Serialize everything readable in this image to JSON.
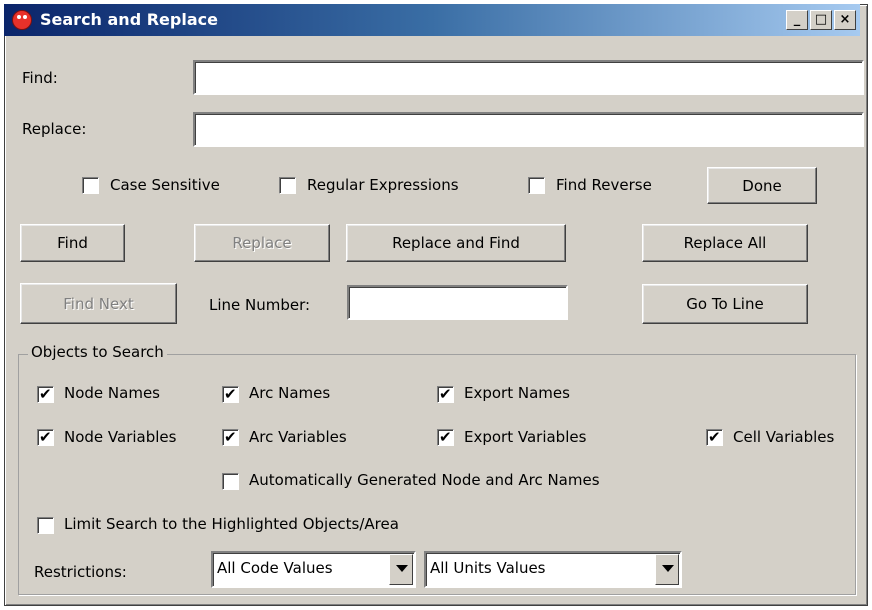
{
  "window": {
    "title": "Search and Replace",
    "controls": {
      "minimize": "_",
      "maximize": "□",
      "close": "×"
    }
  },
  "find": {
    "label": "Find:",
    "value": ""
  },
  "replace": {
    "label": "Replace:",
    "value": ""
  },
  "options": {
    "case_sensitive": {
      "label": "Case Sensitive",
      "checked": false
    },
    "regular_expressions": {
      "label": "Regular Expressions",
      "checked": false
    },
    "find_reverse": {
      "label": "Find Reverse",
      "checked": false
    }
  },
  "buttons": {
    "done": "Done",
    "find": "Find",
    "replace": "Replace",
    "replace_and_find": "Replace and Find",
    "replace_all": "Replace All",
    "find_next": "Find Next",
    "go_to_line": "Go To Line"
  },
  "line_number": {
    "label": "Line Number:",
    "value": ""
  },
  "objects_group": {
    "title": "Objects to Search",
    "node_names": {
      "label": "Node Names",
      "checked": true
    },
    "arc_names": {
      "label": "Arc Names",
      "checked": true
    },
    "export_names": {
      "label": "Export Names",
      "checked": true
    },
    "node_variables": {
      "label": "Node Variables",
      "checked": true
    },
    "arc_variables": {
      "label": "Arc Variables",
      "checked": true
    },
    "export_variables": {
      "label": "Export Variables",
      "checked": true
    },
    "cell_variables": {
      "label": "Cell Variables",
      "checked": true
    },
    "auto_generated": {
      "label": "Automatically Generated Node and Arc Names",
      "checked": false
    },
    "limit_highlighted": {
      "label": "Limit Search to the Highlighted Objects/Area",
      "checked": false
    },
    "restrictions_label": "Restrictions:",
    "code_values": "All Code Values",
    "units_values": "All Units Values"
  }
}
